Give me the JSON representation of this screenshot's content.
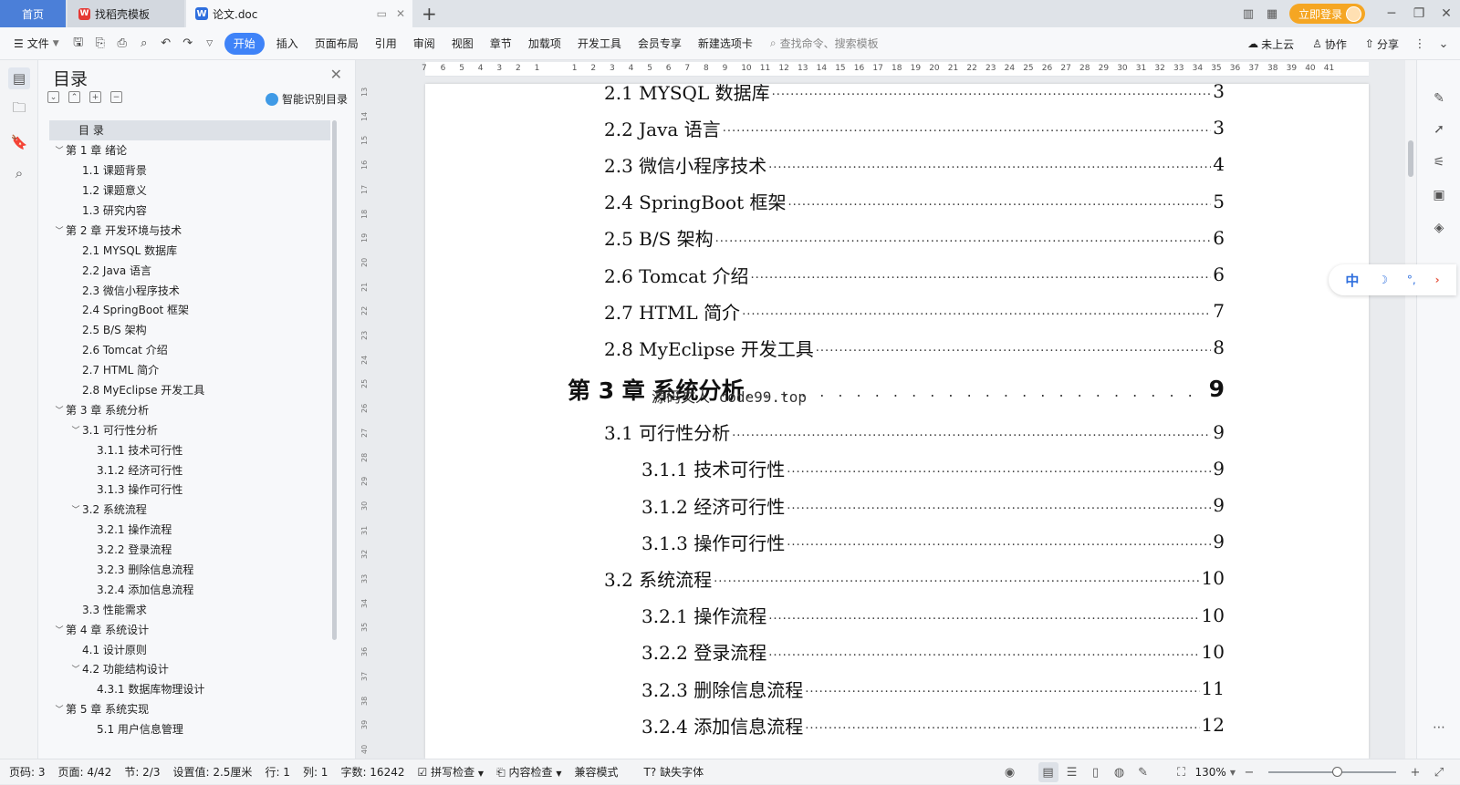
{
  "titlebar": {
    "tab_home": "首页",
    "tab_template": "找稻壳模板",
    "tab_doc": "论文.doc",
    "login": "立即登录"
  },
  "ribbon": {
    "file": "文件",
    "tabs": [
      "开始",
      "插入",
      "页面布局",
      "引用",
      "审阅",
      "视图",
      "章节",
      "加载项",
      "开发工具",
      "会员专享",
      "新建选项卡"
    ],
    "search_placeholder": "查找命令、搜索模板",
    "cloud": "未上云",
    "collab": "协作",
    "share": "分享"
  },
  "toc_panel": {
    "title": "目录",
    "smart": "智能识别目录",
    "items": [
      {
        "label": "目  录",
        "level": 0,
        "caret": "",
        "selected": true
      },
      {
        "label": "第 1 章  绪论",
        "level": 1,
        "caret": "v"
      },
      {
        "label": "1.1  课题背景",
        "level": 2,
        "caret": ""
      },
      {
        "label": "1.2  课题意义",
        "level": 2,
        "caret": ""
      },
      {
        "label": "1.3  研究内容",
        "level": 2,
        "caret": ""
      },
      {
        "label": "第 2 章  开发环境与技术",
        "level": 1,
        "caret": "v"
      },
      {
        "label": "2.1 MYSQL 数据库",
        "level": 2,
        "caret": ""
      },
      {
        "label": "2.2 Java 语言",
        "level": 2,
        "caret": ""
      },
      {
        "label": "2.3  微信小程序技术",
        "level": 2,
        "caret": ""
      },
      {
        "label": "2.4 SpringBoot 框架",
        "level": 2,
        "caret": ""
      },
      {
        "label": "2.5 B/S 架构",
        "level": 2,
        "caret": ""
      },
      {
        "label": "2.6 Tomcat  介绍",
        "level": 2,
        "caret": ""
      },
      {
        "label": "2.7 HTML  简介",
        "level": 2,
        "caret": ""
      },
      {
        "label": "2.8 MyEclipse 开发工具",
        "level": 2,
        "caret": ""
      },
      {
        "label": "第 3 章  系统分析",
        "level": 1,
        "caret": "v"
      },
      {
        "label": "3.1  可行性分析",
        "level": 2,
        "caret": "v"
      },
      {
        "label": "3.1.1  技术可行性",
        "level": 3,
        "caret": ""
      },
      {
        "label": "3.1.2  经济可行性",
        "level": 3,
        "caret": ""
      },
      {
        "label": "3.1.3  操作可行性",
        "level": 3,
        "caret": ""
      },
      {
        "label": "3.2  系统流程",
        "level": 2,
        "caret": "v"
      },
      {
        "label": "3.2.1  操作流程",
        "level": 3,
        "caret": ""
      },
      {
        "label": "3.2.2  登录流程",
        "level": 3,
        "caret": ""
      },
      {
        "label": "3.2.3  删除信息流程",
        "level": 3,
        "caret": ""
      },
      {
        "label": "3.2.4  添加信息流程",
        "level": 3,
        "caret": ""
      },
      {
        "label": "3.3  性能需求",
        "level": 2,
        "caret": ""
      },
      {
        "label": "第 4 章  系统设计",
        "level": 1,
        "caret": "v"
      },
      {
        "label": "4.1  设计原则",
        "level": 2,
        "caret": ""
      },
      {
        "label": "4.2  功能结构设计",
        "level": 2,
        "caret": "v"
      },
      {
        "label": "4.3.1  数据库物理设计",
        "level": 3,
        "caret": ""
      },
      {
        "label": "第 5 章  系统实现",
        "level": 1,
        "caret": "v"
      },
      {
        "label": "5.1 用户信息管理",
        "level": 3,
        "caret": ""
      }
    ]
  },
  "hruler_numbers": [
    "7",
    "6",
    "5",
    "4",
    "3",
    "2",
    "1",
    "",
    "1",
    "2",
    "3",
    "4",
    "5",
    "6",
    "7",
    "8",
    "9",
    "10",
    "11",
    "12",
    "13",
    "14",
    "15",
    "16",
    "17",
    "18",
    "19",
    "20",
    "21",
    "22",
    "23",
    "24",
    "25",
    "26",
    "27",
    "28",
    "29",
    "30",
    "31",
    "32",
    "33",
    "34",
    "35",
    "36",
    "37",
    "38",
    "39",
    "40",
    "41"
  ],
  "vruler_numbers": [
    "13",
    "14",
    "15",
    "16",
    "17",
    "18",
    "19",
    "20",
    "21",
    "22",
    "23",
    "24",
    "25",
    "26",
    "27",
    "28",
    "29",
    "30",
    "31",
    "32",
    "33",
    "34",
    "35",
    "36",
    "37",
    "38",
    "39",
    "40"
  ],
  "page_entries": [
    {
      "label": "2.1 MYSQL 数据库",
      "page": "3",
      "kind": "l2"
    },
    {
      "label": "2.2 Java 语言",
      "page": "3",
      "kind": "l2"
    },
    {
      "label": "2.3  微信小程序技术",
      "page": "4",
      "kind": "l2"
    },
    {
      "label": "2.4 SpringBoot 框架",
      "page": "5",
      "kind": "l2"
    },
    {
      "label": "2.5 B/S 架构",
      "page": "6",
      "kind": "l2"
    },
    {
      "label": "2.6 Tomcat 介绍",
      "page": "6",
      "kind": "l2"
    },
    {
      "label": "2.7 HTML 简介",
      "page": "7",
      "kind": "l2"
    },
    {
      "label": "2.8 MyEclipse 开发工具",
      "page": "8",
      "kind": "l2"
    },
    {
      "label": "第 3 章  系统分析",
      "page": "9",
      "kind": "ch"
    },
    {
      "label": "3.1  可行性分析",
      "page": "9",
      "kind": "l2"
    },
    {
      "label": "3.1.1  技术可行性",
      "page": "9",
      "kind": "l3"
    },
    {
      "label": "3.1.2  经济可行性",
      "page": "9",
      "kind": "l3"
    },
    {
      "label": "3.1.3  操作可行性",
      "page": "9",
      "kind": "l3"
    },
    {
      "label": "3.2  系统流程",
      "page": "10",
      "kind": "l2"
    },
    {
      "label": "3.2.1  操作流程",
      "page": "10",
      "kind": "l3"
    },
    {
      "label": "3.2.2  登录流程",
      "page": "10",
      "kind": "l3"
    },
    {
      "label": "3.2.3  删除信息流程",
      "page": "11",
      "kind": "l3"
    },
    {
      "label": "3.2.4  添加信息流程",
      "page": "12",
      "kind": "l3"
    }
  ],
  "watermark": "源码文人 code99.top",
  "ime": {
    "lang": "中"
  },
  "statusbar": {
    "page_code": "页码: 3",
    "page": "页面: 4/42",
    "section": "节: 2/3",
    "setting": "设置值: 2.5厘米",
    "row": "行: 1",
    "col": "列: 1",
    "words": "字数: 16242",
    "spell": "拼写检查",
    "content_check": "内容检查",
    "compat": "兼容模式",
    "missing_font": "缺失字体",
    "zoom": "130%"
  }
}
